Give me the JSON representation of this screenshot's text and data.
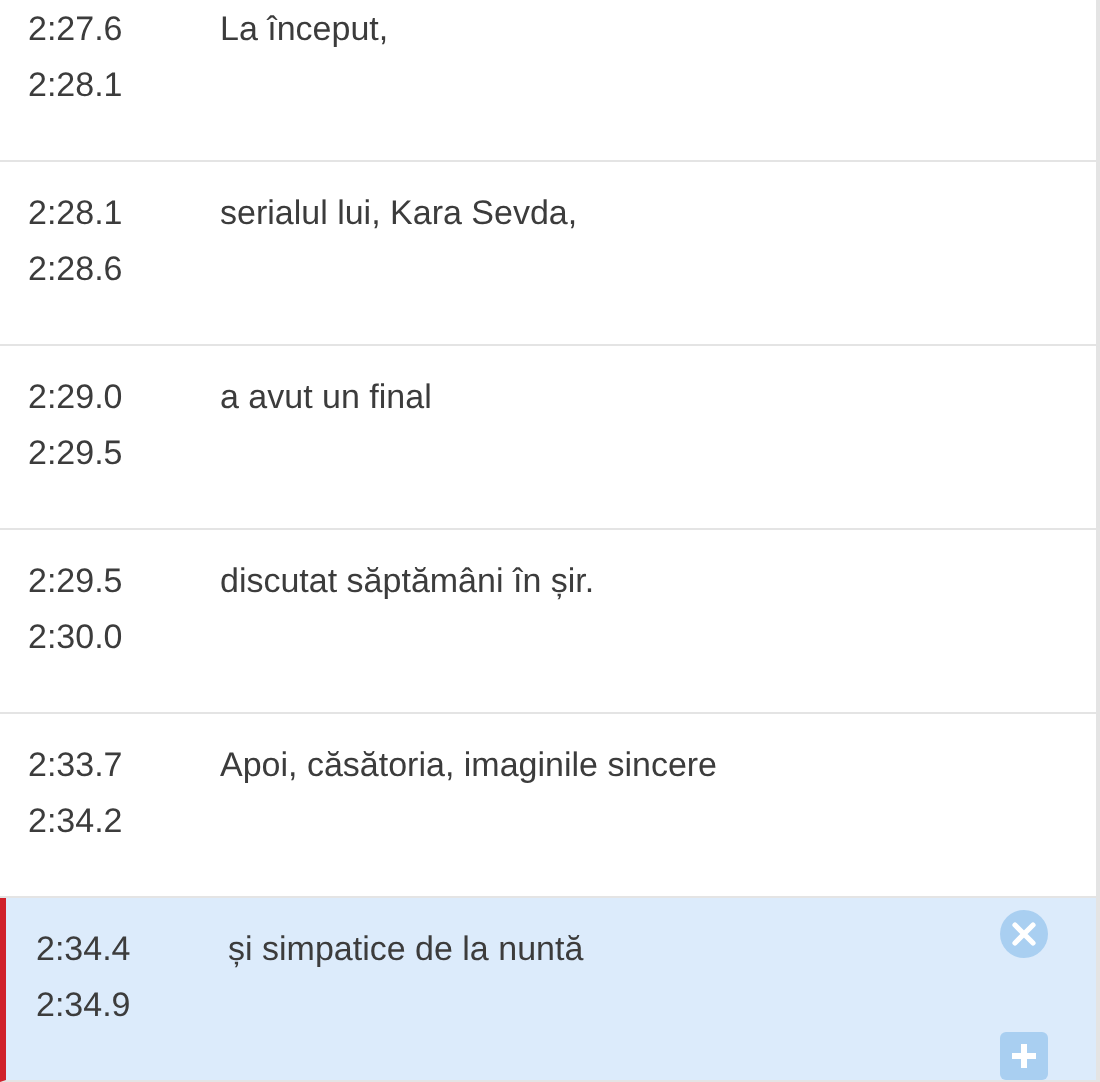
{
  "segments": [
    {
      "start": "2:27.6",
      "end": "2:28.1",
      "text": "La început,",
      "selected": false
    },
    {
      "start": "2:28.1",
      "end": "2:28.6",
      "text": "serialul lui, Kara Sevda,",
      "selected": false
    },
    {
      "start": "2:29.0",
      "end": "2:29.5",
      "text": "a avut un final",
      "selected": false
    },
    {
      "start": "2:29.5",
      "end": "2:30.0",
      "text": "discutat săptămâni în șir.",
      "selected": false
    },
    {
      "start": "2:33.7",
      "end": "2:34.2",
      "text": "Apoi, căsătoria, imaginile sincere",
      "selected": false
    },
    {
      "start": "2:34.4",
      "end": "2:34.9",
      "text": "și simpatice de la nuntă",
      "selected": true
    }
  ]
}
